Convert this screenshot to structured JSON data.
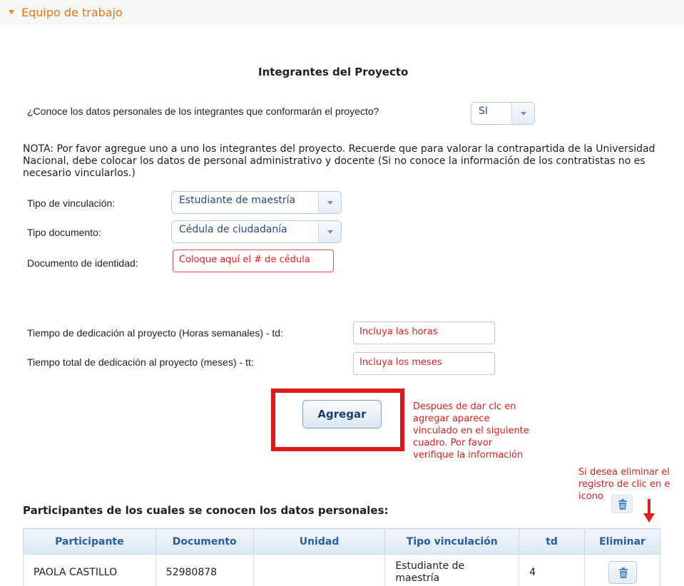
{
  "section": {
    "title": "Equipo de trabajo"
  },
  "heading": "Integrantes del Proyecto",
  "question": {
    "text": "¿Conoce los datos personales de los integrantes que conformarán el proyecto?",
    "selected": "SI"
  },
  "note": "NOTA: Por favor agregue uno a uno los integrantes del proyecto. Recuerde que para valorar la contrapartida de la Universidad Nacional, debe colocar los datos de personal administrativo y docente (Si no conoce la información de los contratistas no es necesario vincularlos.)",
  "form": {
    "tipo_vinculacion_label": "Tipo de vinculación:",
    "tipo_vinculacion_value": "Estudiante de maestría",
    "tipo_documento_label": "Tipo documento:",
    "tipo_documento_value": "Cédula de ciudadanía",
    "documento_label": "Documento de identidad:",
    "documento_hint": "Coloque aquí el # de cédula",
    "td_label": "Tiempo de dedicación al proyecto (Horas semanales) - td:",
    "td_hint": "Incluya las horas",
    "tt_label": "Tiempo total de dedicación al proyecto (meses) - tt:",
    "tt_hint": "Incluya los meses"
  },
  "add_button": "Agregar",
  "annotations": {
    "after_add": [
      "Despues de dar clc en",
      "agregar aparece",
      "vinculado en el siguiente",
      "cuadro. Por favor",
      "verifique la información"
    ],
    "delete_hint": [
      "Si desea eliminar el",
      "registro de clic en e",
      "icono"
    ]
  },
  "participants": {
    "title": "Participantes de los cuales se conocen los datos personales:",
    "columns": [
      "Participante",
      "Documento",
      "Unidad",
      "Tipo vinculación",
      "td",
      "Eliminar"
    ],
    "rows": [
      {
        "participante": "PAOLA CASTILLO",
        "documento": "52980878",
        "unidad": "",
        "tipo": "Estudiante de maestría",
        "td": "4"
      }
    ]
  },
  "colors": {
    "accent": "#e07a10",
    "annotation": "#e02020",
    "header_text": "#2a5d9a"
  },
  "icons": {
    "delete": "trash-icon",
    "caret": "caret-down-icon",
    "pointer": "red-arrow-down-icon"
  }
}
